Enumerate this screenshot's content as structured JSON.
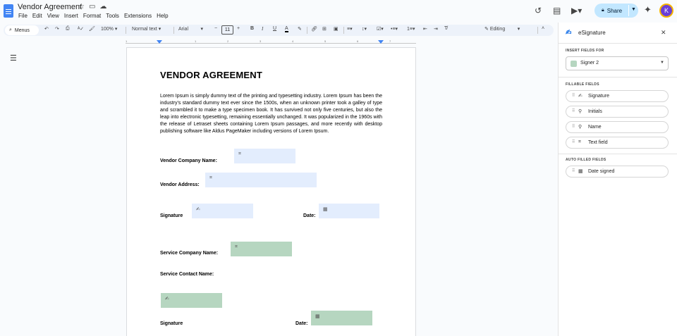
{
  "doc_title": "Vendor Agreement",
  "title_icons": [
    "star-icon",
    "folder-icon",
    "cloud-icon"
  ],
  "menu": [
    "File",
    "Edit",
    "View",
    "Insert",
    "Format",
    "Tools",
    "Extensions",
    "Help"
  ],
  "header": {
    "share_label": "Share",
    "avatar_initial": "K"
  },
  "toolbar": {
    "menus_label": "Menus",
    "zoom": "100%",
    "style": "Normal text",
    "font": "Arial",
    "font_size": "11",
    "mode": "Editing",
    "bold": "B",
    "italic": "I",
    "underline": "U",
    "text_color": "A"
  },
  "ruler_numbers": [
    "1",
    "1",
    "2",
    "3",
    "4",
    "5",
    "6",
    "7"
  ],
  "document": {
    "heading": "VENDOR AGREEMENT",
    "paragraph": "Lorem Ipsum is simply dummy text of the printing and typesetting industry. Lorem Ipsum has been the industry's standard dummy text ever since the 1500s, when an unknown printer took a galley of type and scrambled it to make a type specimen book. It has survived not only five centuries, but also the leap into electronic typesetting, remaining essentially unchanged. It was popularized in the 1960s with the release of Letraset sheets containing Lorem Ipsum passages, and more recently with desktop publishing software like Aldus PageMaker including versions of Lorem Ipsum.",
    "labels": {
      "vendor_company": "Vendor Company Name:",
      "vendor_address": "Vendor Address:",
      "signature_1": "Signature",
      "date_1": "Date:",
      "service_company": "Service Company Name:",
      "service_contact": "Service Contact Name:",
      "signature_2": "Signature",
      "date_2": "Date:"
    },
    "field_colors": {
      "signer_1": "#e3edfd",
      "signer_2": "#b6d6c0"
    }
  },
  "panel": {
    "title": "eSignature",
    "insert_fields_for": "INSERT FIELDS FOR",
    "signer": "Signer 2",
    "fillable_fields_heading": "FILLABLE FIELDS",
    "fillable_fields": [
      "Signature",
      "Initials",
      "Name",
      "Text field"
    ],
    "auto_filled_heading": "AUTO FILLED FIELDS",
    "auto_filled_fields": [
      "Date signed"
    ]
  }
}
